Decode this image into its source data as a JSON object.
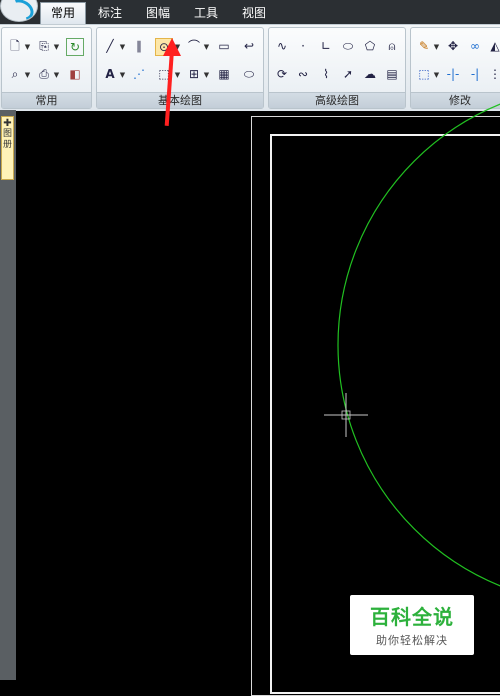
{
  "tabs": [
    {
      "label": "常用",
      "active": true
    },
    {
      "label": "标注",
      "active": false
    },
    {
      "label": "图幅",
      "active": false
    },
    {
      "label": "工具",
      "active": false
    },
    {
      "label": "视图",
      "active": false
    }
  ],
  "panels": {
    "common": {
      "title": "常用"
    },
    "basic_draw": {
      "title": "基本绘图"
    },
    "advanced_draw": {
      "title": "高级绘图"
    },
    "modify": {
      "title": "修改"
    }
  },
  "sidebar": {
    "tab_label": "图 册"
  },
  "watermark": {
    "title": "百科全说",
    "subtitle": "助你轻松解决"
  },
  "colors": {
    "circle": "#21c021",
    "annotation_arrow": "#ff2020",
    "crosshair": "#c8c8c8"
  }
}
